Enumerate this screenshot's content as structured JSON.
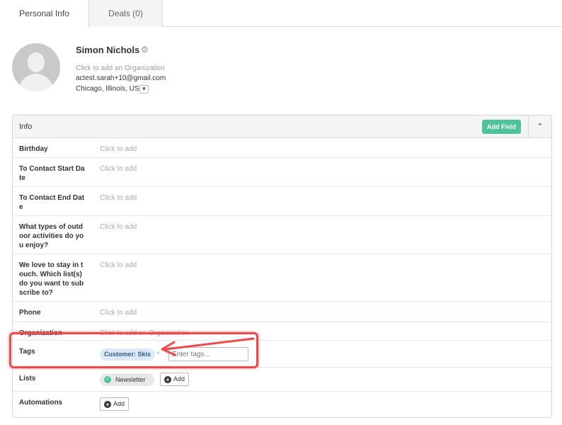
{
  "tabs": [
    {
      "label": "Personal Info",
      "active": true
    },
    {
      "label": "Deals (0)",
      "active": false
    }
  ],
  "contact": {
    "name": "Simon Nichols",
    "organization_placeholder": "Click to add an Organization",
    "email": "actest.sarah+10@gmail.com",
    "location": "Chicago, Illinois, US"
  },
  "info_panel": {
    "title": "Info",
    "add_field_label": "Add Field",
    "collapse_icon": "chevron-up-icon",
    "fields": [
      {
        "label": "Birthday",
        "value": "Click to add"
      },
      {
        "label": "To Contact Start Date",
        "value": "Click to add"
      },
      {
        "label": "To Contact End Date",
        "value": "Click to add"
      },
      {
        "label": "What types of outdoor activities do you enjoy?",
        "value": "Click to add"
      },
      {
        "label": "We love to stay in touch. Which list(s) do you want to subscribe to?",
        "value": "Click to add"
      },
      {
        "label": "Phone",
        "value": "Click to add"
      },
      {
        "label": "Organization",
        "value": "Click to add an Organization"
      }
    ],
    "tags": {
      "label": "Tags",
      "chips": [
        "Customer: Skis"
      ],
      "input_placeholder": "Enter tags..."
    },
    "lists": {
      "label": "Lists",
      "chips": [
        "Newsletter"
      ],
      "add_label": "Add"
    },
    "automations": {
      "label": "Automations",
      "add_label": "Add"
    }
  },
  "colors": {
    "accent_green": "#4fc39b",
    "tag_chip_bg": "#dde9f7",
    "annotation_red": "#ef4a4a"
  }
}
